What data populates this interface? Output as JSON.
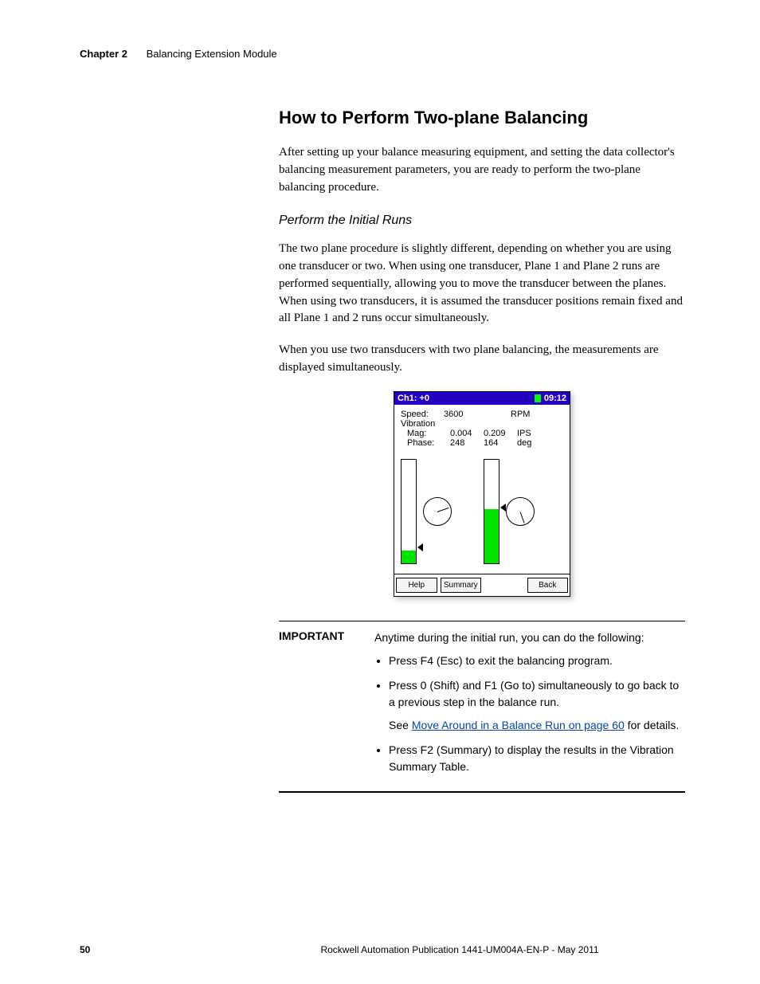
{
  "header": {
    "chapter": "Chapter 2",
    "title": "Balancing Extension Module"
  },
  "section_heading": "How to Perform Two-plane Balancing",
  "para1": "After setting up your balance measuring equipment, and setting the data collector's balancing measurement parameters, you are ready to perform the two-plane balancing procedure.",
  "subhead": "Perform the Initial Runs",
  "para2": "The two plane procedure is slightly different, depending on whether you are using one transducer or two. When using one transducer, Plane 1 and Plane 2 runs are performed sequentially, allowing you to move the transducer between the planes. When using two transducers, it is assumed the transducer positions remain fixed and all Plane 1 and 2 runs occur simultaneously.",
  "para3": "When you use two transducers with two plane balancing, the measurements are displayed simultaneously.",
  "screenshot": {
    "title_left": "Ch1: +0",
    "title_time": "09:12",
    "speed_lbl": "Speed:",
    "speed_val": "3600",
    "speed_unit": "RPM",
    "vib_lbl": "Vibration",
    "mag_lbl": "Mag:",
    "mag_v1": "0.004",
    "mag_v2": "0.209",
    "mag_unit": "IPS",
    "phase_lbl": "Phase:",
    "phase_v1": "248",
    "phase_v2": "164",
    "phase_unit": "deg",
    "btn_help": "Help",
    "btn_summary": "Summary",
    "btn_back": "Back"
  },
  "callout": {
    "label": "IMPORTANT",
    "intro": "Anytime during the initial run, you can do the following:",
    "b1": "Press F4 (Esc) to exit the balancing program.",
    "b2": "Press 0 (Shift) and F1 (Go to) simultaneously to go back to a previous step in the balance run.",
    "see_pre": "See ",
    "see_link": "Move Around in a Balance Run on page 60",
    "see_post": " for details.",
    "b3": "Press F2 (Summary) to display the results in the Vibration Summary Table."
  },
  "footer": {
    "page": "50",
    "pub": "Rockwell Automation Publication 1441-UM004A-EN-P - May 2011"
  }
}
